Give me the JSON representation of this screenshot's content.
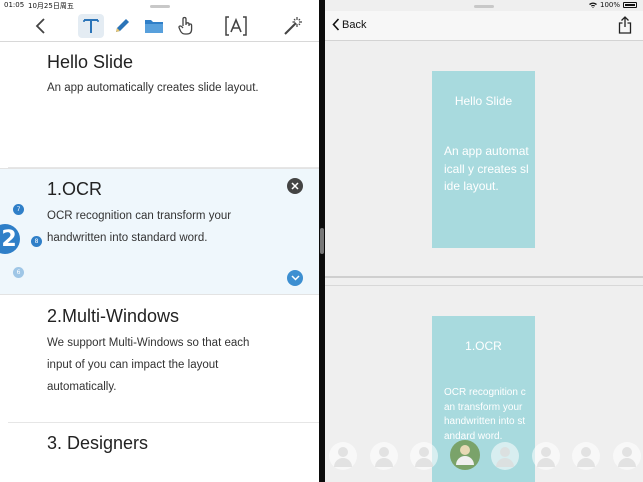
{
  "status_bar": {
    "time": "01:05",
    "date": "10月25日周五",
    "battery": "100%"
  },
  "toolbar": {
    "icons": [
      "back-chevron-icon",
      "text-tool-icon",
      "pencil-icon",
      "folder-icon",
      "hand-pointer-icon",
      "text-box-icon",
      "magic-wand-icon"
    ],
    "active_tool": "text-tool-icon"
  },
  "document": {
    "blocks": [
      {
        "title": "Hello Slide",
        "body": "An app automatically creates slide layout."
      },
      {
        "title": "1.OCR",
        "body": "OCR recognition can transform your handwritten into standard word."
      },
      {
        "title": "2.Multi-Windows",
        "body": "We support Multi-Windows so that each input of you can impact the layout automatically."
      },
      {
        "title": "3. Designers",
        "body": ""
      }
    ],
    "page_bubble": "2",
    "mini_dots": [
      "7",
      "8",
      "6"
    ]
  },
  "preview": {
    "back_label": "Back",
    "slides": [
      {
        "title": "Hello Slide",
        "body": "An app automaticall y creates slide layout."
      },
      {
        "title": "1.OCR",
        "body": "OCR recognition can transform your handwritten into standard word."
      }
    ],
    "avatar_count": 8,
    "selected_avatar": 3
  },
  "colors": {
    "slide_bg": "#a8dade",
    "accent": "#2f7fc8",
    "selected_block_bg": "#eff7fc"
  }
}
